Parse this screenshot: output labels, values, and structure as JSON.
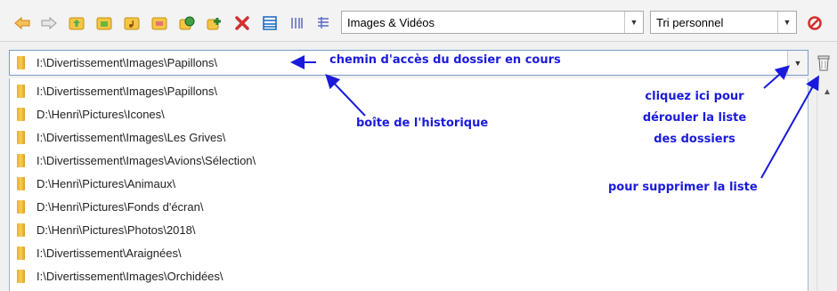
{
  "toolbar": {
    "buttons": [
      {
        "icon": "back-arrow-icon",
        "color": "#e8a23a"
      },
      {
        "icon": "forward-arrow-icon",
        "color": "#bdbdbd"
      },
      {
        "icon": "folder-up-icon",
        "color": "#f2c94c"
      },
      {
        "icon": "folder-images-icon",
        "color": "#7cb342"
      },
      {
        "icon": "folder-music-icon",
        "color": "#f2c94c"
      },
      {
        "icon": "folder-video-icon",
        "color": "#f2c94c"
      },
      {
        "icon": "folder-globe-icon",
        "color": "#2e7d32"
      },
      {
        "icon": "folder-add-icon",
        "color": "#2e7d32"
      },
      {
        "icon": "delete-x-icon",
        "color": "#d32f2f"
      },
      {
        "icon": "view-list-icon",
        "color": "#1565c0"
      },
      {
        "icon": "view-columns-icon",
        "color": "#5c6bc0"
      },
      {
        "icon": "view-details-icon",
        "color": "#5c6bc0"
      }
    ],
    "filter_combo": {
      "value": "Images & Vidéos"
    },
    "sort_combo": {
      "value": "Tri personnel"
    },
    "stop_icon": "no-entry-icon"
  },
  "path": {
    "current": "I:\\Divertissement\\Images\\Papillons\\"
  },
  "history": [
    "I:\\Divertissement\\Images\\Papillons\\",
    "D:\\Henri\\Pictures\\Icones\\",
    "I:\\Divertissement\\Images\\Les Grives\\",
    "I:\\Divertissement\\Images\\Avions\\Sélection\\",
    "D:\\Henri\\Pictures\\Animaux\\",
    "D:\\Henri\\Pictures\\Fonds d'écran\\",
    "D:\\Henri\\Pictures\\Photos\\2018\\",
    "I:\\Divertissement\\Araignées\\",
    "I:\\Divertissement\\Images\\Orchidées\\"
  ],
  "annotations": {
    "path_note": "chemin d'accès du dossier en cours",
    "history_note": "boîte de l'historique",
    "dropdown_note_line1": "cliquez ici pour",
    "dropdown_note_line2": "dérouler la liste",
    "dropdown_note_line3": "des dossiers",
    "delete_note": "pour supprimer la liste"
  },
  "colors": {
    "annotation": "#1a1adc",
    "folder": "#f0b838"
  }
}
